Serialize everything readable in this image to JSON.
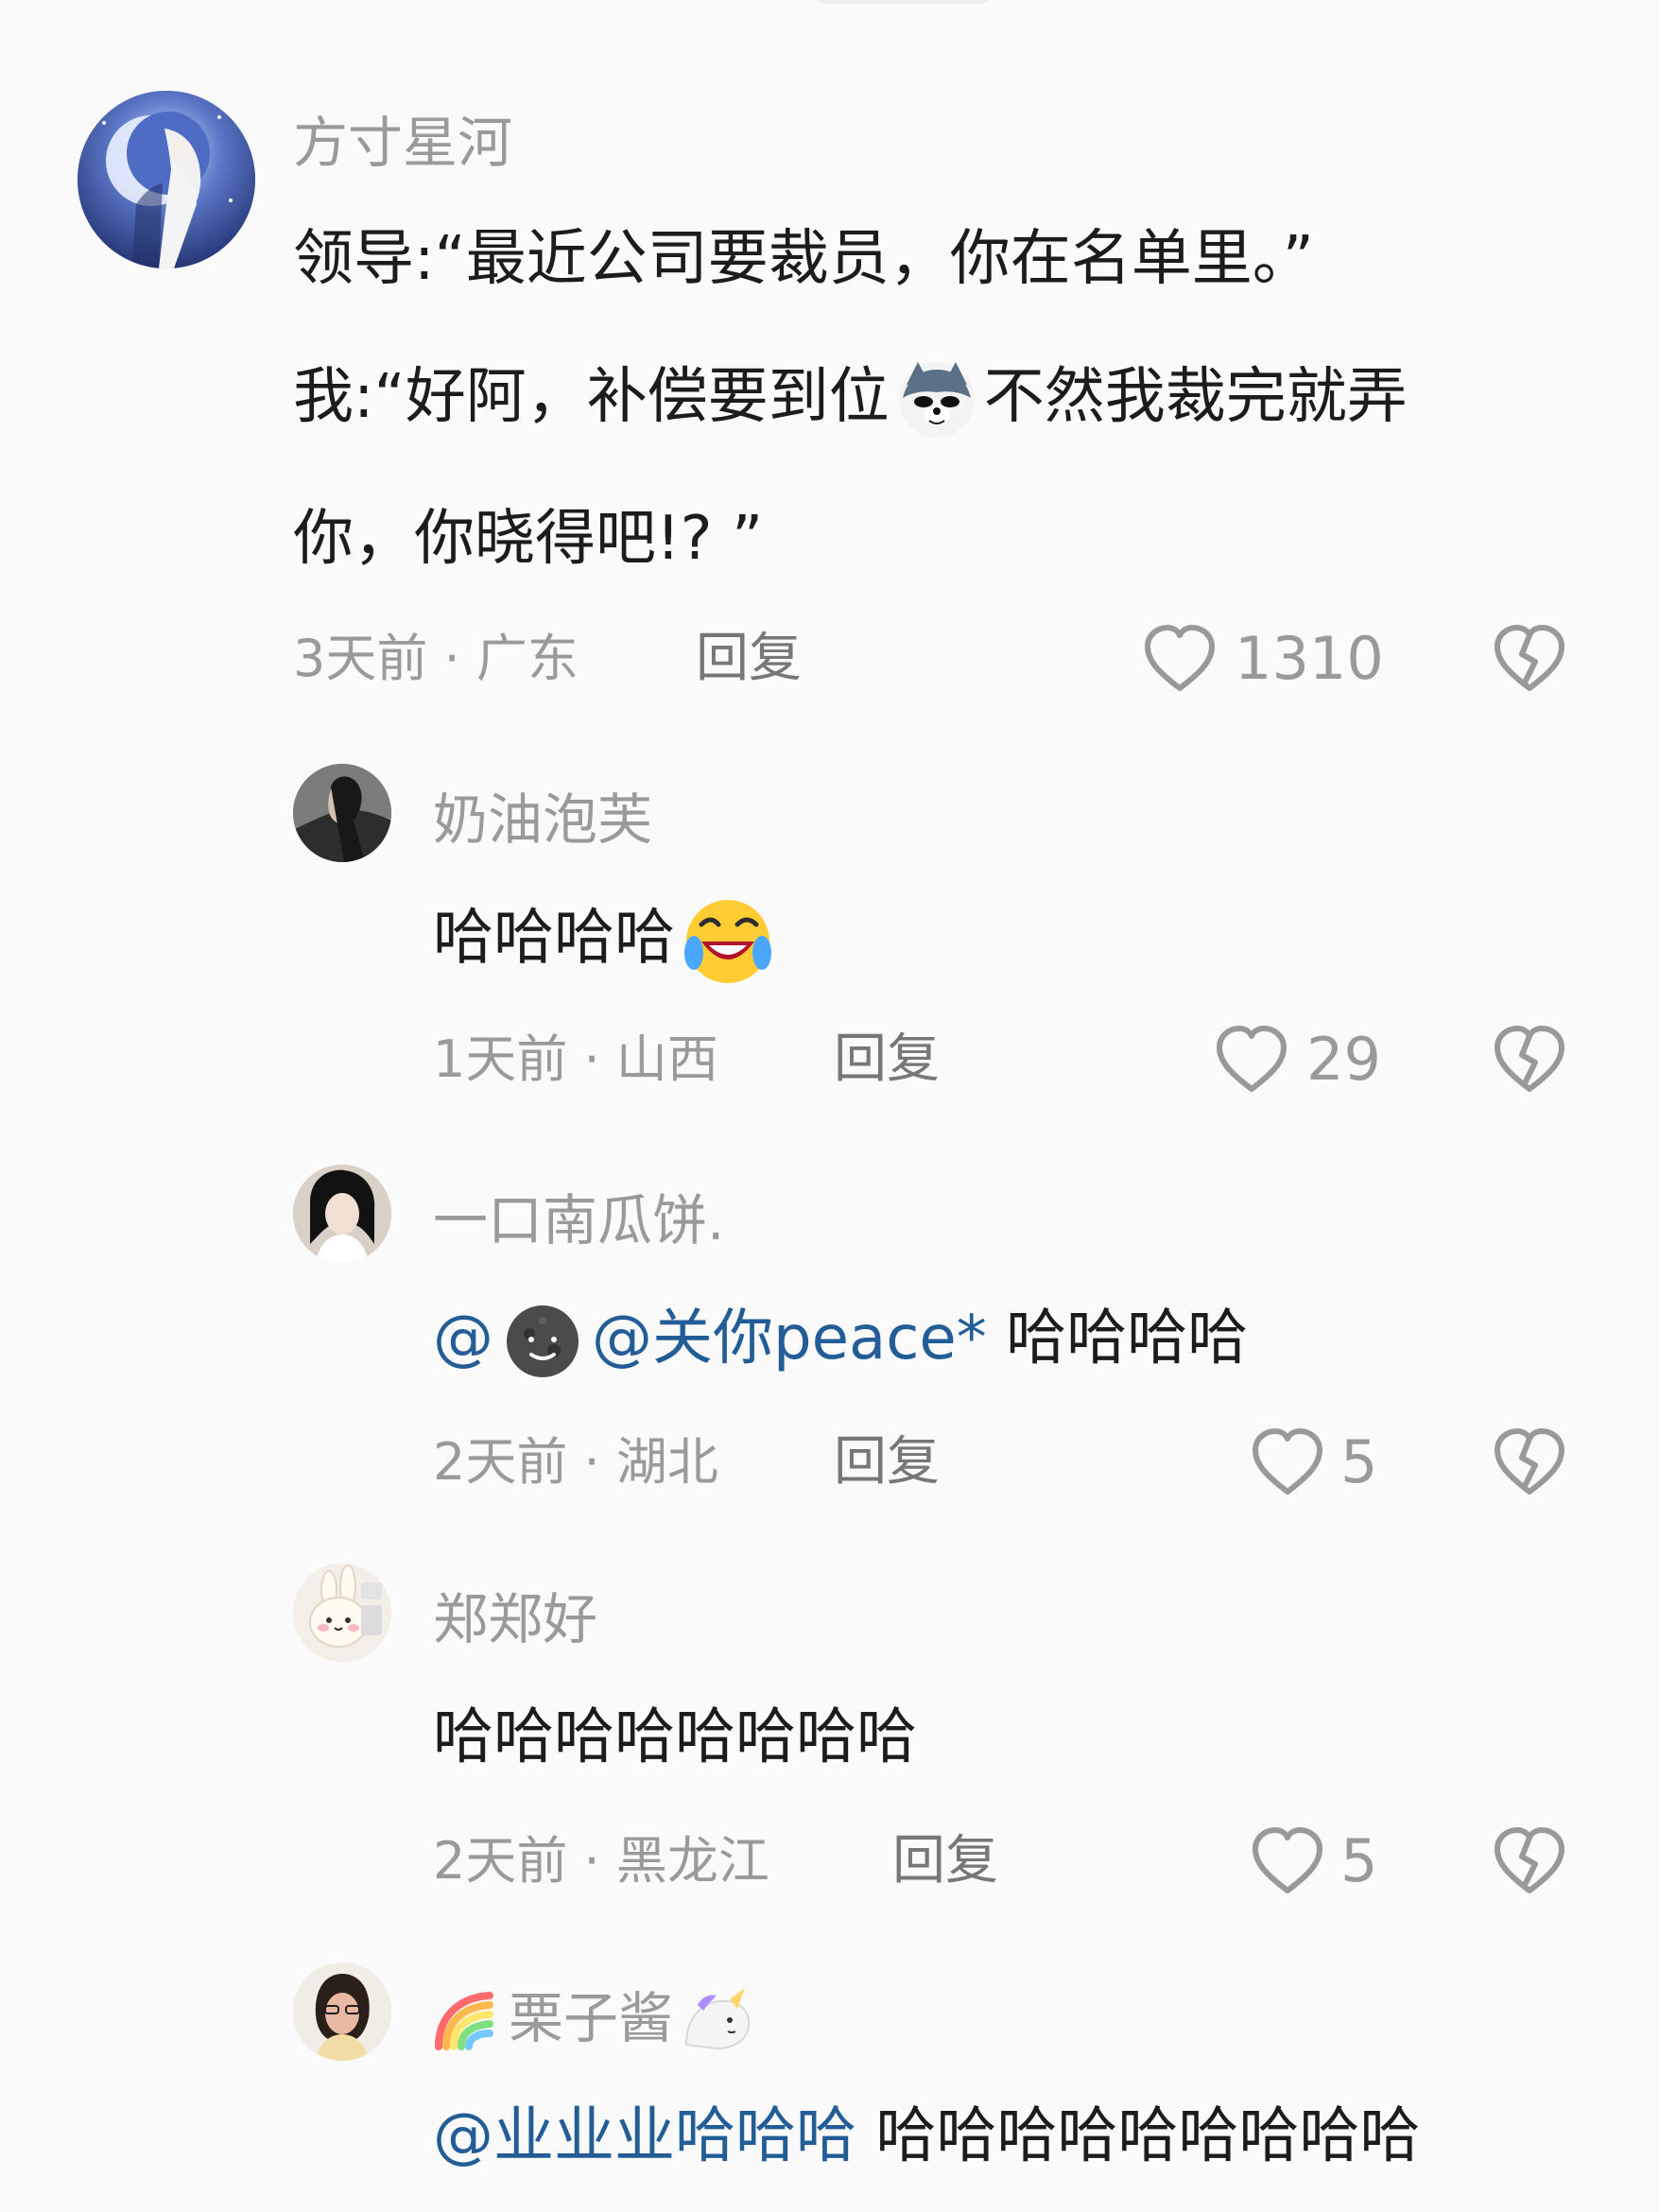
{
  "comments": [
    {
      "username": "方寸星河",
      "lines": [
        "领导:“最近公司要裁员，你在名单里。”",
        "我:“好阿，补偿要到位",
        "不然我裁完就弄",
        "你，你晓得吧!? ”"
      ],
      "time_location": "3天前 · 广东",
      "reply_label": "回复",
      "likes": "1310",
      "avatar_icon": "anime-avatar-icon",
      "inline_emoji": "wolf-emoji-icon"
    },
    {
      "username": "奶油泡芙",
      "text": "哈哈哈哈",
      "time_location": "1天前 · 山西",
      "reply_label": "回复",
      "likes": "29",
      "avatar_icon": "portrait-avatar-icon",
      "inline_emoji": "laugh-cry-emoji-icon"
    },
    {
      "username": "一口南瓜饼.",
      "mention_prefix": "@",
      "mention_name": "@关你peace*",
      "text": " 哈哈哈哈",
      "time_location": "2天前 · 湖北",
      "reply_label": "回复",
      "likes": "5",
      "avatar_icon": "girl-avatar-icon",
      "inline_emoji": "moon-emoji-icon"
    },
    {
      "username": "郑郑好",
      "text": "哈哈哈哈哈哈哈哈",
      "time_location": "2天前 · 黑龙江",
      "reply_label": "回复",
      "likes": "5",
      "avatar_icon": "bunny-avatar-icon"
    },
    {
      "username": "栗子酱",
      "mention_name": "@业业业哈哈哈",
      "text": " 哈哈哈哈哈哈哈哈哈",
      "avatar_icon": "woman-avatar-icon",
      "prefix_emoji": "rainbow-emoji-icon",
      "suffix_emoji": "unicorn-emoji-icon"
    }
  ],
  "colors": {
    "background": "#fafafa",
    "text": "#1c1c1c",
    "muted": "#9a9a9a",
    "mention": "#225d97"
  }
}
